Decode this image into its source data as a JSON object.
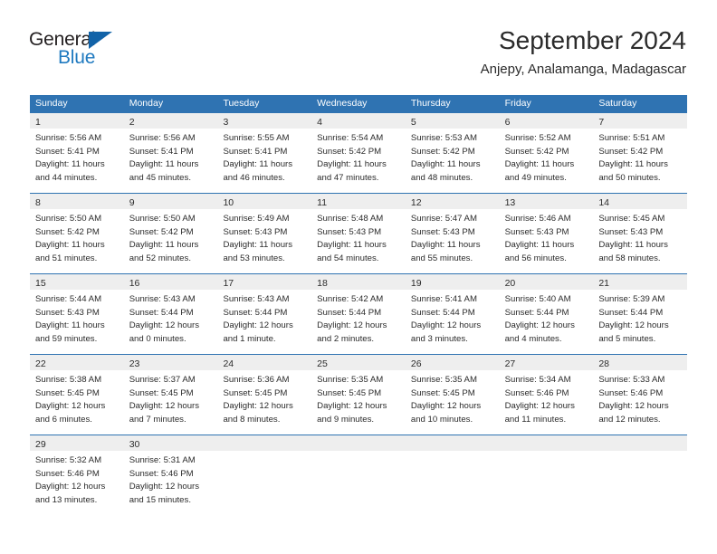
{
  "logo": {
    "word1": "General",
    "word2": "Blue",
    "triangle_color": "#1263a8",
    "blue_text_color": "#1f7ac0"
  },
  "header": {
    "title": "September 2024",
    "subtitle": "Anjepy, Analamanga, Madagascar"
  },
  "theme": {
    "header_row_bg": "#2f73b2",
    "day_band_bg": "#eeeeee",
    "rule_color": "#2f73b2",
    "text_color": "#2b2b2b"
  },
  "weekdays": [
    "Sunday",
    "Monday",
    "Tuesday",
    "Wednesday",
    "Thursday",
    "Friday",
    "Saturday"
  ],
  "weeks": [
    [
      {
        "day": "1",
        "sunrise": "Sunrise: 5:56 AM",
        "sunset": "Sunset: 5:41 PM",
        "daylight1": "Daylight: 11 hours",
        "daylight2": "and 44 minutes."
      },
      {
        "day": "2",
        "sunrise": "Sunrise: 5:56 AM",
        "sunset": "Sunset: 5:41 PM",
        "daylight1": "Daylight: 11 hours",
        "daylight2": "and 45 minutes."
      },
      {
        "day": "3",
        "sunrise": "Sunrise: 5:55 AM",
        "sunset": "Sunset: 5:41 PM",
        "daylight1": "Daylight: 11 hours",
        "daylight2": "and 46 minutes."
      },
      {
        "day": "4",
        "sunrise": "Sunrise: 5:54 AM",
        "sunset": "Sunset: 5:42 PM",
        "daylight1": "Daylight: 11 hours",
        "daylight2": "and 47 minutes."
      },
      {
        "day": "5",
        "sunrise": "Sunrise: 5:53 AM",
        "sunset": "Sunset: 5:42 PM",
        "daylight1": "Daylight: 11 hours",
        "daylight2": "and 48 minutes."
      },
      {
        "day": "6",
        "sunrise": "Sunrise: 5:52 AM",
        "sunset": "Sunset: 5:42 PM",
        "daylight1": "Daylight: 11 hours",
        "daylight2": "and 49 minutes."
      },
      {
        "day": "7",
        "sunrise": "Sunrise: 5:51 AM",
        "sunset": "Sunset: 5:42 PM",
        "daylight1": "Daylight: 11 hours",
        "daylight2": "and 50 minutes."
      }
    ],
    [
      {
        "day": "8",
        "sunrise": "Sunrise: 5:50 AM",
        "sunset": "Sunset: 5:42 PM",
        "daylight1": "Daylight: 11 hours",
        "daylight2": "and 51 minutes."
      },
      {
        "day": "9",
        "sunrise": "Sunrise: 5:50 AM",
        "sunset": "Sunset: 5:42 PM",
        "daylight1": "Daylight: 11 hours",
        "daylight2": "and 52 minutes."
      },
      {
        "day": "10",
        "sunrise": "Sunrise: 5:49 AM",
        "sunset": "Sunset: 5:43 PM",
        "daylight1": "Daylight: 11 hours",
        "daylight2": "and 53 minutes."
      },
      {
        "day": "11",
        "sunrise": "Sunrise: 5:48 AM",
        "sunset": "Sunset: 5:43 PM",
        "daylight1": "Daylight: 11 hours",
        "daylight2": "and 54 minutes."
      },
      {
        "day": "12",
        "sunrise": "Sunrise: 5:47 AM",
        "sunset": "Sunset: 5:43 PM",
        "daylight1": "Daylight: 11 hours",
        "daylight2": "and 55 minutes."
      },
      {
        "day": "13",
        "sunrise": "Sunrise: 5:46 AM",
        "sunset": "Sunset: 5:43 PM",
        "daylight1": "Daylight: 11 hours",
        "daylight2": "and 56 minutes."
      },
      {
        "day": "14",
        "sunrise": "Sunrise: 5:45 AM",
        "sunset": "Sunset: 5:43 PM",
        "daylight1": "Daylight: 11 hours",
        "daylight2": "and 58 minutes."
      }
    ],
    [
      {
        "day": "15",
        "sunrise": "Sunrise: 5:44 AM",
        "sunset": "Sunset: 5:43 PM",
        "daylight1": "Daylight: 11 hours",
        "daylight2": "and 59 minutes."
      },
      {
        "day": "16",
        "sunrise": "Sunrise: 5:43 AM",
        "sunset": "Sunset: 5:44 PM",
        "daylight1": "Daylight: 12 hours",
        "daylight2": "and 0 minutes."
      },
      {
        "day": "17",
        "sunrise": "Sunrise: 5:43 AM",
        "sunset": "Sunset: 5:44 PM",
        "daylight1": "Daylight: 12 hours",
        "daylight2": "and 1 minute."
      },
      {
        "day": "18",
        "sunrise": "Sunrise: 5:42 AM",
        "sunset": "Sunset: 5:44 PM",
        "daylight1": "Daylight: 12 hours",
        "daylight2": "and 2 minutes."
      },
      {
        "day": "19",
        "sunrise": "Sunrise: 5:41 AM",
        "sunset": "Sunset: 5:44 PM",
        "daylight1": "Daylight: 12 hours",
        "daylight2": "and 3 minutes."
      },
      {
        "day": "20",
        "sunrise": "Sunrise: 5:40 AM",
        "sunset": "Sunset: 5:44 PM",
        "daylight1": "Daylight: 12 hours",
        "daylight2": "and 4 minutes."
      },
      {
        "day": "21",
        "sunrise": "Sunrise: 5:39 AM",
        "sunset": "Sunset: 5:44 PM",
        "daylight1": "Daylight: 12 hours",
        "daylight2": "and 5 minutes."
      }
    ],
    [
      {
        "day": "22",
        "sunrise": "Sunrise: 5:38 AM",
        "sunset": "Sunset: 5:45 PM",
        "daylight1": "Daylight: 12 hours",
        "daylight2": "and 6 minutes."
      },
      {
        "day": "23",
        "sunrise": "Sunrise: 5:37 AM",
        "sunset": "Sunset: 5:45 PM",
        "daylight1": "Daylight: 12 hours",
        "daylight2": "and 7 minutes."
      },
      {
        "day": "24",
        "sunrise": "Sunrise: 5:36 AM",
        "sunset": "Sunset: 5:45 PM",
        "daylight1": "Daylight: 12 hours",
        "daylight2": "and 8 minutes."
      },
      {
        "day": "25",
        "sunrise": "Sunrise: 5:35 AM",
        "sunset": "Sunset: 5:45 PM",
        "daylight1": "Daylight: 12 hours",
        "daylight2": "and 9 minutes."
      },
      {
        "day": "26",
        "sunrise": "Sunrise: 5:35 AM",
        "sunset": "Sunset: 5:45 PM",
        "daylight1": "Daylight: 12 hours",
        "daylight2": "and 10 minutes."
      },
      {
        "day": "27",
        "sunrise": "Sunrise: 5:34 AM",
        "sunset": "Sunset: 5:46 PM",
        "daylight1": "Daylight: 12 hours",
        "daylight2": "and 11 minutes."
      },
      {
        "day": "28",
        "sunrise": "Sunrise: 5:33 AM",
        "sunset": "Sunset: 5:46 PM",
        "daylight1": "Daylight: 12 hours",
        "daylight2": "and 12 minutes."
      }
    ],
    [
      {
        "day": "29",
        "sunrise": "Sunrise: 5:32 AM",
        "sunset": "Sunset: 5:46 PM",
        "daylight1": "Daylight: 12 hours",
        "daylight2": "and 13 minutes."
      },
      {
        "day": "30",
        "sunrise": "Sunrise: 5:31 AM",
        "sunset": "Sunset: 5:46 PM",
        "daylight1": "Daylight: 12 hours",
        "daylight2": "and 15 minutes."
      },
      {
        "day": "",
        "sunrise": "",
        "sunset": "",
        "daylight1": "",
        "daylight2": ""
      },
      {
        "day": "",
        "sunrise": "",
        "sunset": "",
        "daylight1": "",
        "daylight2": ""
      },
      {
        "day": "",
        "sunrise": "",
        "sunset": "",
        "daylight1": "",
        "daylight2": ""
      },
      {
        "day": "",
        "sunrise": "",
        "sunset": "",
        "daylight1": "",
        "daylight2": ""
      },
      {
        "day": "",
        "sunrise": "",
        "sunset": "",
        "daylight1": "",
        "daylight2": ""
      }
    ]
  ]
}
